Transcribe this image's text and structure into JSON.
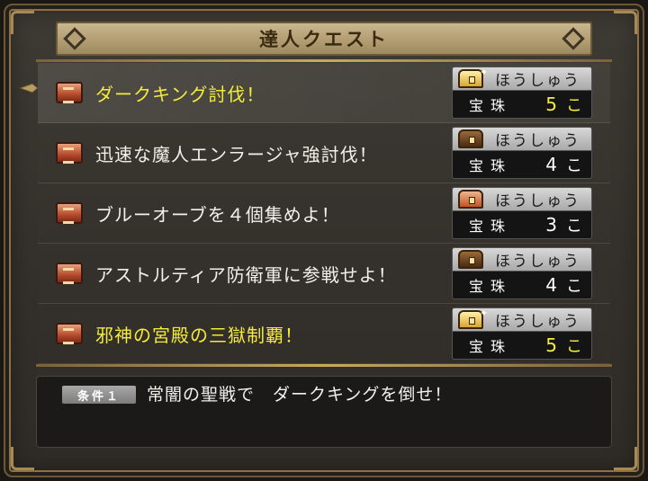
{
  "window": {
    "title": "達人クエスト"
  },
  "quests": [
    {
      "name": "ダークキング討伐！",
      "highlight": true,
      "reward": {
        "label": "ほうしゅう",
        "item": "宝珠",
        "qty": "5",
        "unit": "こ",
        "qty_highlight": true,
        "chest": "gold"
      }
    },
    {
      "name": "迅速な魔人エンラージャ強討伐！",
      "highlight": false,
      "reward": {
        "label": "ほうしゅう",
        "item": "宝珠",
        "qty": "4",
        "unit": "こ",
        "qty_highlight": false,
        "chest": "dark"
      }
    },
    {
      "name": "ブルーオーブを４個集めよ！",
      "highlight": false,
      "reward": {
        "label": "ほうしゅう",
        "item": "宝珠",
        "qty": "3",
        "unit": "こ",
        "qty_highlight": false,
        "chest": "red"
      }
    },
    {
      "name": "アストルティア防衛軍に参戦せよ！",
      "highlight": false,
      "reward": {
        "label": "ほうしゅう",
        "item": "宝珠",
        "qty": "4",
        "unit": "こ",
        "qty_highlight": false,
        "chest": "dark"
      }
    },
    {
      "name": "邪神の宮殿の三獄制覇！",
      "highlight": true,
      "reward": {
        "label": "ほうしゅう",
        "item": "宝珠",
        "qty": "5",
        "unit": "こ",
        "qty_highlight": true,
        "chest": "gold"
      }
    }
  ],
  "condition": {
    "tag": "条件１",
    "text": "常闇の聖戦で　ダークキングを倒せ！"
  },
  "colors": {
    "highlight_text": "#f4ec3a",
    "normal_text": "#f2f0ea",
    "title_bar": "#b5a075"
  }
}
